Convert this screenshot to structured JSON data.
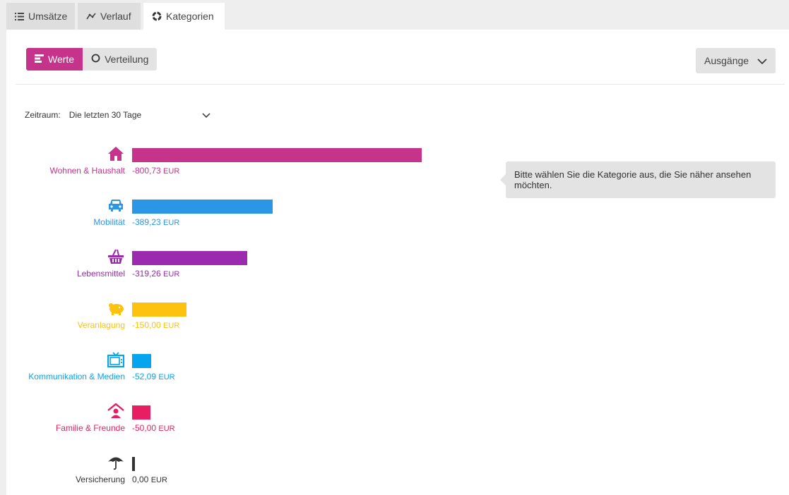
{
  "tabs": [
    {
      "label": "Umsätze",
      "icon": "list-icon",
      "active": false
    },
    {
      "label": "Verlauf",
      "icon": "line-chart-icon",
      "active": false
    },
    {
      "label": "Kategorien",
      "icon": "donut-icon",
      "active": true
    }
  ],
  "view_toggle": {
    "werte_label": "Werte",
    "verteilung_label": "Verteilung",
    "active": "Werte"
  },
  "direction_select": {
    "value": "Ausgänge"
  },
  "period": {
    "label": "Zeitraum:",
    "value": "Die letzten 30 Tage"
  },
  "tooltip": {
    "text": "Bitte wählen Sie die Kategorie aus, die Sie näher ansehen möchten."
  },
  "colors": {
    "accent": "#c6338b",
    "wohnen": "#c6338b",
    "mobilitaet": "#2b96e6",
    "lebensmittel": "#9c2aae",
    "veranlagung": "#fcc20f",
    "kommunikation": "#05a4ee",
    "familie": "#e81e63",
    "versicherung": "#333333"
  },
  "chart_data": {
    "type": "bar",
    "orientation": "horizontal",
    "currency": "EUR",
    "categories": [
      "Wohnen & Haushalt",
      "Mobilität",
      "Lebensmittel",
      "Veranlagung",
      "Kommunikation & Medien",
      "Familie & Freunde",
      "Versicherung"
    ],
    "values": [
      -800.73,
      -389.23,
      -319.26,
      -150.0,
      -52.09,
      -50.0,
      0.0
    ],
    "amount_texts": [
      "-800,73",
      "-389,23",
      "-319,26",
      "-150,00",
      "-52,09",
      "-50,00",
      "0,00"
    ],
    "icons": [
      "house-icon",
      "car-icon",
      "basket-icon",
      "piggy-bank-icon",
      "tv-icon",
      "family-icon",
      "umbrella-icon"
    ],
    "color_keys": [
      "wohnen",
      "mobilitaet",
      "lebensmittel",
      "veranlagung",
      "kommunikation",
      "familie",
      "versicherung"
    ]
  }
}
